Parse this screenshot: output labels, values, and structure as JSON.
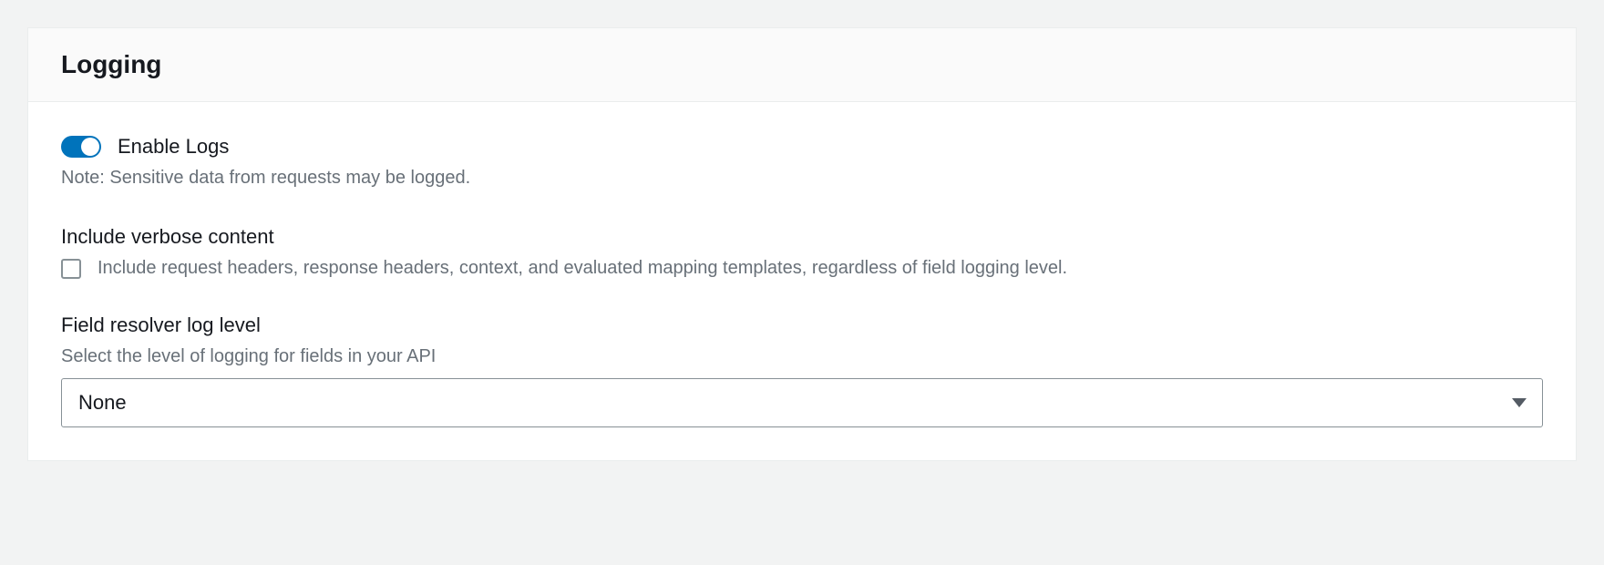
{
  "panel": {
    "title": "Logging"
  },
  "enableLogs": {
    "label": "Enable Logs",
    "enabled": true,
    "note": "Note: Sensitive data from requests may be logged."
  },
  "verbose": {
    "heading": "Include verbose content",
    "checked": false,
    "description": "Include request headers, response headers, context, and evaluated mapping templates, regardless of field logging level."
  },
  "logLevel": {
    "heading": "Field resolver log level",
    "description": "Select the level of logging for fields in your API",
    "selected": "None"
  }
}
